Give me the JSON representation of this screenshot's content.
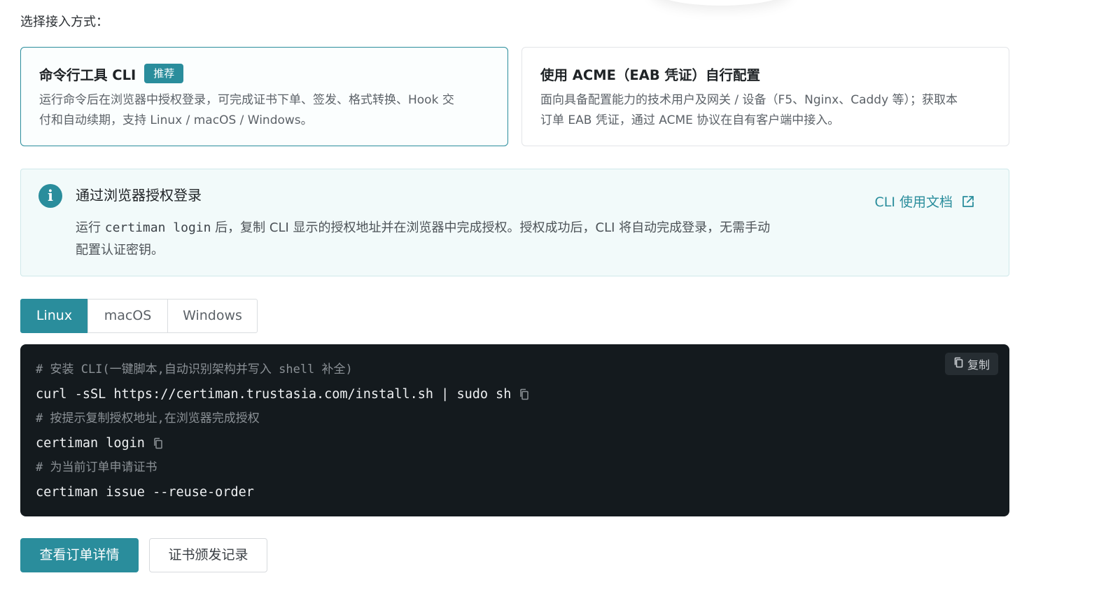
{
  "choose_label": "选择接入方式：",
  "methods": [
    {
      "title": "命令行工具 CLI",
      "badge": "推荐",
      "desc_line1": "运行命令后在浏览器中授权登录，可完成证书下单、签发、格式转换、Hook 交",
      "desc_line2": "付和自动续期，支持 Linux / macOS / Windows。"
    },
    {
      "title": "使用 ACME（EAB 凭证）自行配置",
      "desc_line1": "面向具备配置能力的技术用户及网关 / 设备（F5、Nginx、Caddy 等）；获取本",
      "desc_line2": "订单 EAB 凭证，通过 ACME 协议在自有客户端中接入。"
    }
  ],
  "info": {
    "icon": "info-icon",
    "title": "通过浏览器授权登录",
    "body_prefix": "运行 ",
    "body_code": "certiman login",
    "body_line1_rest": " 后，复制 CLI 显示的授权地址并在浏览器中完成授权。授权成功后，CLI 将自动完成登录，无需手动",
    "body_line2": "配置认证密钥。",
    "doc_link": "CLI 使用文档",
    "doc_link_icon": "external-link-icon"
  },
  "tabs": [
    "Linux",
    "macOS",
    "Windows"
  ],
  "active_tab": "Linux",
  "code": {
    "copy_label": "复制",
    "lines": [
      {
        "type": "comment",
        "text": "# 安装 CLI(一键脚本,自动识别架构并写入 shell 补全)"
      },
      {
        "type": "cmd",
        "text": "curl -sSL https://certiman.trustasia.com/install.sh | sudo sh"
      },
      {
        "type": "comment",
        "text": "# 按提示复制授权地址,在浏览器完成授权"
      },
      {
        "type": "cmd",
        "text": "certiman login"
      },
      {
        "type": "comment",
        "text": "# 为当前订单申请证书"
      },
      {
        "type": "cmd",
        "text": "certiman issue --reuse-order"
      }
    ]
  },
  "actions": {
    "primary": "查看订单详情",
    "secondary": "证书颁发记录"
  },
  "colors": {
    "accent": "#2a8d9c",
    "code_bg": "#141a1e",
    "info_bg": "#f2fafa"
  }
}
